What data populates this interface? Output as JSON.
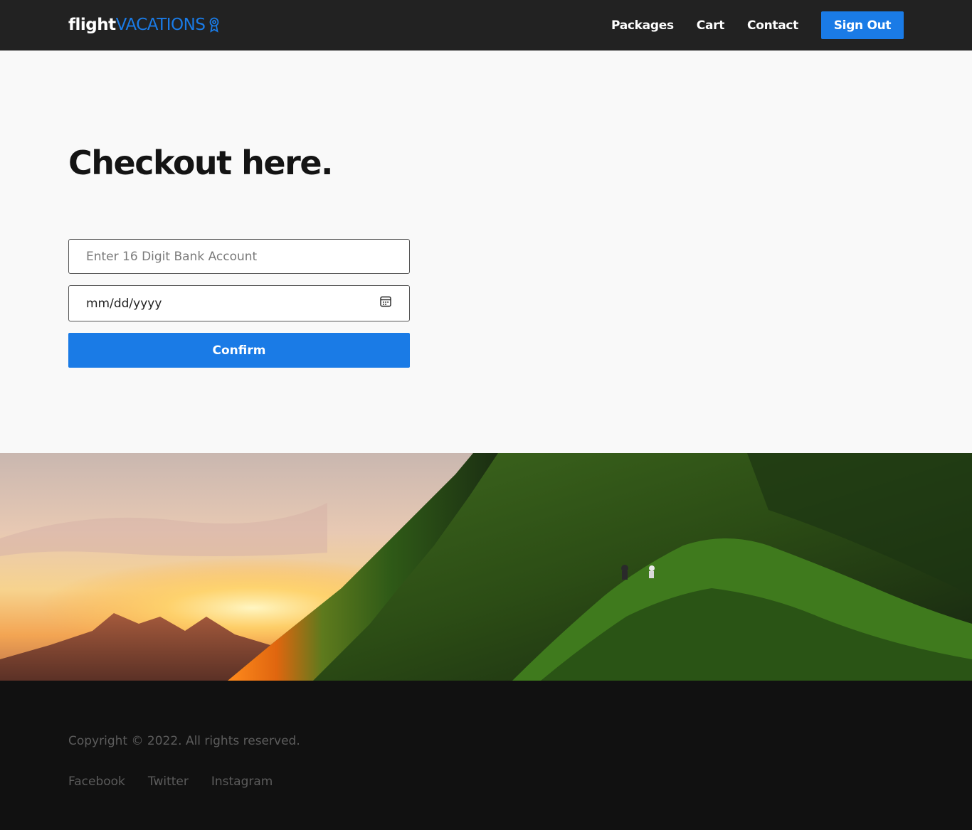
{
  "header": {
    "logo_primary": "flight",
    "logo_secondary": "VACATIONS",
    "logo_icon": "award-icon",
    "nav": {
      "packages": "Packages",
      "cart": "Cart",
      "contact": "Contact"
    },
    "signout_label": "Sign Out"
  },
  "main": {
    "title": "Checkout here.",
    "account_placeholder": "Enter 16 Digit Bank Account",
    "date_placeholder": "mm/dd/yyyy",
    "date_icon": "calendar-icon",
    "confirm_label": "Confirm"
  },
  "banner": {
    "image": "mountain-sunset-photo"
  },
  "footer": {
    "copyright": "Copyright © 2022. All rights reserved.",
    "social": {
      "facebook": "Facebook",
      "twitter": "Twitter",
      "instagram": "Instagram"
    }
  },
  "colors": {
    "accent": "#1a7be6",
    "header_bg": "#222222",
    "footer_bg": "#111111",
    "page_bg": "#f9f9f9"
  }
}
